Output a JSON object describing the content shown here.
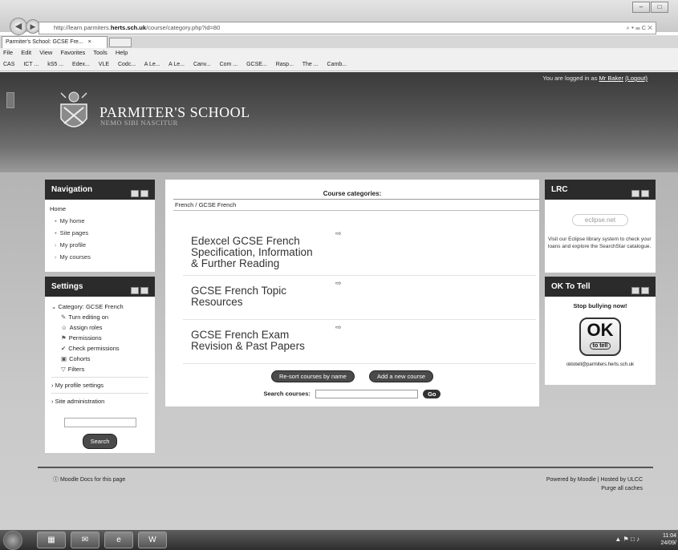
{
  "browser": {
    "url_prefix": "http://learn.parmiters.",
    "url_host": "herts.sch.uk",
    "url_path": "/course/category.php?id=80",
    "url_controls": "⌕ ▾ ☰ C ✕",
    "tab_title": "Parmiter's School: GCSE Fre...",
    "tab_close": "×",
    "menu": [
      "File",
      "Edit",
      "View",
      "Favorites",
      "Tools",
      "Help"
    ],
    "favorites": [
      "CAS",
      "ICT ...",
      "kS5 ...",
      "Edex...",
      "VLE",
      "Codc...",
      "A Le...",
      "A Le...",
      "Canv...",
      "Com ...",
      "GCSE...",
      "Rasp...",
      "The ...",
      "Camb..."
    ],
    "window_controls": [
      "–",
      "□"
    ]
  },
  "header": {
    "login_text": "You are logged in as ",
    "login_user": "Mr Baker",
    "logout_label": "(Logout)",
    "school_name": "PARMITER'S SCHOOL",
    "motto": "NEMO SIBI NASCITUR"
  },
  "navigation": {
    "title": "Navigation",
    "home": "Home",
    "items": [
      {
        "bullet": "▪",
        "label": "My home"
      },
      {
        "bullet": "▪",
        "label": "Site pages"
      },
      {
        "bullet": "›",
        "label": "My profile"
      },
      {
        "bullet": "›",
        "label": "My courses"
      }
    ]
  },
  "settings": {
    "title": "Settings",
    "category_label": "Category: GCSE French",
    "items": [
      {
        "icon": "✎",
        "label": "Turn editing on"
      },
      {
        "icon": "☺",
        "label": "Assign roles"
      },
      {
        "icon": "⚑",
        "label": "Permissions"
      },
      {
        "icon": "✔",
        "label": "Check permissions"
      },
      {
        "icon": "▣",
        "label": "Cohorts"
      },
      {
        "icon": "▽",
        "label": "Filters"
      }
    ],
    "profile_settings": "My profile settings",
    "site_admin": "Site administration",
    "search_button": "Search"
  },
  "main": {
    "heading": "Course categories:",
    "breadcrumb": "French / GCSE French",
    "courses": [
      {
        "name": "Edexcel GCSE French Specification, Information & Further Reading"
      },
      {
        "name": "GCSE French Topic Resources"
      },
      {
        "name": "GCSE French Exam Revision & Past Papers"
      }
    ],
    "resort_button": "Re-sort courses by name",
    "add_button": "Add a new course",
    "search_label": "Search courses:",
    "go_button": "Go"
  },
  "lrc": {
    "title": "LRC",
    "logo_text": "eclipse.net",
    "text": "Visit our Eclipse library system to check your loans and explore the SearchStar catalogue."
  },
  "ok_to_tell": {
    "title": "OK To Tell",
    "strap": "Stop bullying now!",
    "logo_big": "OK",
    "logo_small": "to tell",
    "email": "oktotell@parmiters.herts.sch.uk"
  },
  "footer": {
    "docs_link": "Moodle Docs for this page",
    "powered_prefix": "Powered by ",
    "powered_link": "Moodle",
    "hosted_prefix": " | Hosted by ",
    "hosted_link": "ULCC",
    "purge": "Purge all caches"
  },
  "taskbar": {
    "time": "11:04",
    "date": "24/09/"
  }
}
